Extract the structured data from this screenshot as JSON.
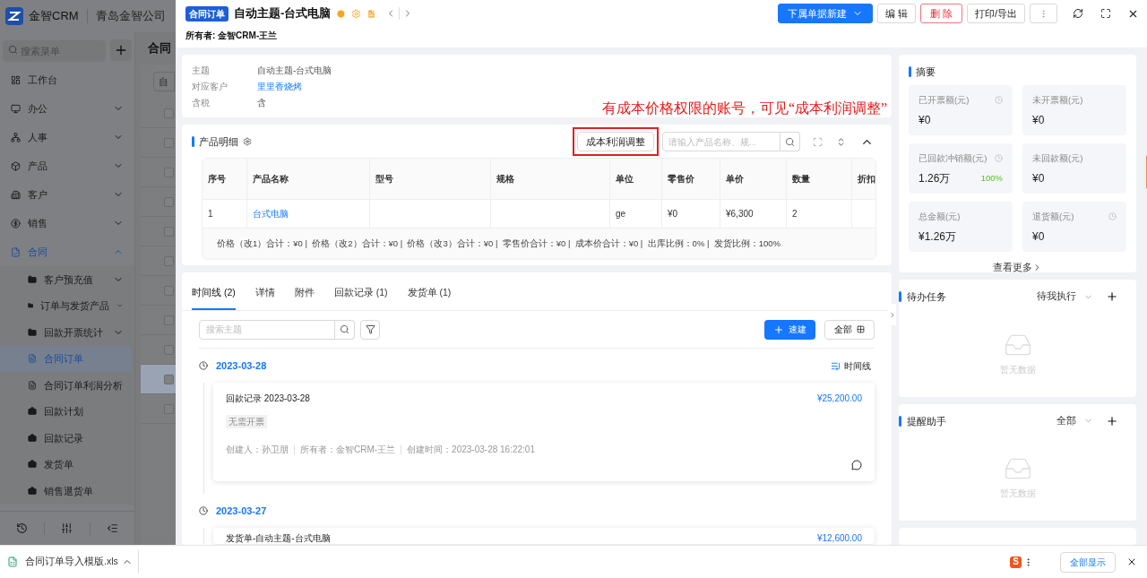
{
  "sidebar": {
    "brand": "金智CRM",
    "company": "青岛金智公司",
    "search": {
      "placeholder": "搜索菜单"
    },
    "menu": [
      {
        "label": "工作台",
        "kind": "link",
        "selected": false
      },
      {
        "label": "办公",
        "kind": "group",
        "expanded": false,
        "selected": false
      },
      {
        "label": "人事",
        "kind": "group",
        "expanded": false,
        "selected": false
      },
      {
        "label": "产品",
        "kind": "group",
        "expanded": false,
        "selected": false
      },
      {
        "label": "客户",
        "kind": "group",
        "expanded": false,
        "selected": false
      },
      {
        "label": "销售",
        "kind": "group",
        "expanded": false,
        "selected": false
      },
      {
        "label": "合同",
        "kind": "group",
        "expanded": true,
        "selected": false,
        "children": [
          {
            "label": "客户预充值",
            "kind": "folder",
            "expanded": false,
            "selected": false
          },
          {
            "label": "订单与发货产品",
            "kind": "folder",
            "expanded": false,
            "selected": false
          },
          {
            "label": "回款开票统计",
            "kind": "folder",
            "expanded": false,
            "selected": false
          },
          {
            "label": "合同订单",
            "kind": "doc",
            "selected": true
          },
          {
            "label": "合同订单利润分析",
            "kind": "doc",
            "selected": false
          },
          {
            "label": "回款计划",
            "kind": "record",
            "selected": false
          },
          {
            "label": "回款记录",
            "kind": "record",
            "selected": false
          },
          {
            "label": "发货单",
            "kind": "record",
            "selected": false
          },
          {
            "label": "销售退货单",
            "kind": "record",
            "selected": false
          }
        ]
      }
    ]
  },
  "background_page": {
    "title": "合同",
    "button": "自",
    "rows": [
      {
        "checked": false,
        "selected": false
      },
      {
        "checked": false,
        "selected": false
      },
      {
        "checked": false,
        "selected": false
      },
      {
        "checked": false,
        "selected": false
      },
      {
        "checked": false,
        "selected": false
      },
      {
        "checked": false,
        "selected": false
      },
      {
        "checked": false,
        "selected": false
      },
      {
        "checked": false,
        "selected": false
      },
      {
        "checked": false,
        "selected": false
      },
      {
        "checked": false,
        "selected": true
      },
      {
        "checked": false,
        "selected": false
      }
    ]
  },
  "drawer": {
    "tag": "合同订单",
    "title": "自动主题-台式电脑",
    "owner": "所有者: 金智CRM-王兰",
    "actions": [
      {
        "label": "下属单据新建",
        "kind": "primary"
      },
      {
        "label": "编 辑",
        "kind": "default"
      },
      {
        "label": "删 除",
        "kind": "danger"
      },
      {
        "label": "打印/导出",
        "kind": "default"
      }
    ],
    "info": [
      {
        "label": "主题",
        "value": "自动主题-台式电脑",
        "kind": "text"
      },
      {
        "label": "对应客户",
        "value": "里里香烧烤",
        "kind": "link"
      },
      {
        "label": "含税",
        "value": "含",
        "kind": "text"
      }
    ],
    "annotation": "有成本价格权限的账号，可见“成本利润调整”",
    "products": {
      "title": "产品明细",
      "adjust_button": "成本利润调整",
      "search": {
        "placeholder": "请输入产品名称、规..."
      },
      "columns": [
        "序号",
        "产品名称",
        "型号",
        "规格",
        "单位",
        "零售价",
        "单价",
        "数量",
        "折扣"
      ],
      "rows": [
        {
          "no": "1",
          "name": "台式电脑",
          "unit": "ge",
          "retail_price": "¥0",
          "unit_price": "¥6,300",
          "quantity": "2"
        }
      ],
      "summary": "价格（改1）合计：¥0 |  价格（改2）合计：¥0 |  价格（改3）合计：¥0 |  零售价合计：¥0 |  成本价合计：¥0 |  出库比例：0% |  发货比例：100%"
    },
    "timeline": {
      "tabs": [
        {
          "label": "时间线 (2)",
          "selected": true
        },
        {
          "label": "详情",
          "selected": false
        },
        {
          "label": "附件",
          "selected": false
        },
        {
          "label": "回款记录 (1)",
          "selected": false
        },
        {
          "label": "发货单 (1)",
          "selected": false
        }
      ],
      "search": {
        "placeholder": "搜索主题"
      },
      "quick_create": "速建",
      "filter_all": "全部",
      "view_toggle": "时间线",
      "groups": [
        {
          "date": "2023-03-28",
          "entries": [
            {
              "title": "回款记录 2023-03-28",
              "amount": "¥25,200.00",
              "tag": "无需开票",
              "meta": [
                "创建人：孙卫朋",
                "所有者：金智CRM-王兰",
                "创建时间：2023-03-28 16:22:01"
              ]
            }
          ]
        },
        {
          "date": "2023-03-27",
          "entries": [
            {
              "title": "发货单-自动主题-台式电脑",
              "amount": "¥12,600.00"
            }
          ]
        }
      ]
    },
    "summary": {
      "title": "摘要",
      "stats": [
        {
          "label": "已开票额(元)",
          "value": "¥0",
          "history": true
        },
        {
          "label": "未开票额(元)",
          "value": "¥0",
          "history": false
        },
        {
          "label": "已回款冲销额(元)",
          "value": "1.26万",
          "rate": "100%",
          "history": true
        },
        {
          "label": "未回款额(元)",
          "value": "¥0",
          "history": false
        },
        {
          "label": "总金额(元)",
          "value": "¥1.26万",
          "history": false
        },
        {
          "label": "退货额(元)",
          "value": "¥0",
          "history": true
        }
      ],
      "more": "查看更多"
    },
    "tasks": {
      "title": "待办任务",
      "filter": "待我执行",
      "empty": "暂无数据"
    },
    "reminders": {
      "title": "提醒助手",
      "filter": "全部",
      "empty": "暂无数据"
    }
  },
  "downloads": {
    "file": "合同订单导入模版.xls",
    "ime_logo": "S",
    "show_all": "全部显示"
  }
}
